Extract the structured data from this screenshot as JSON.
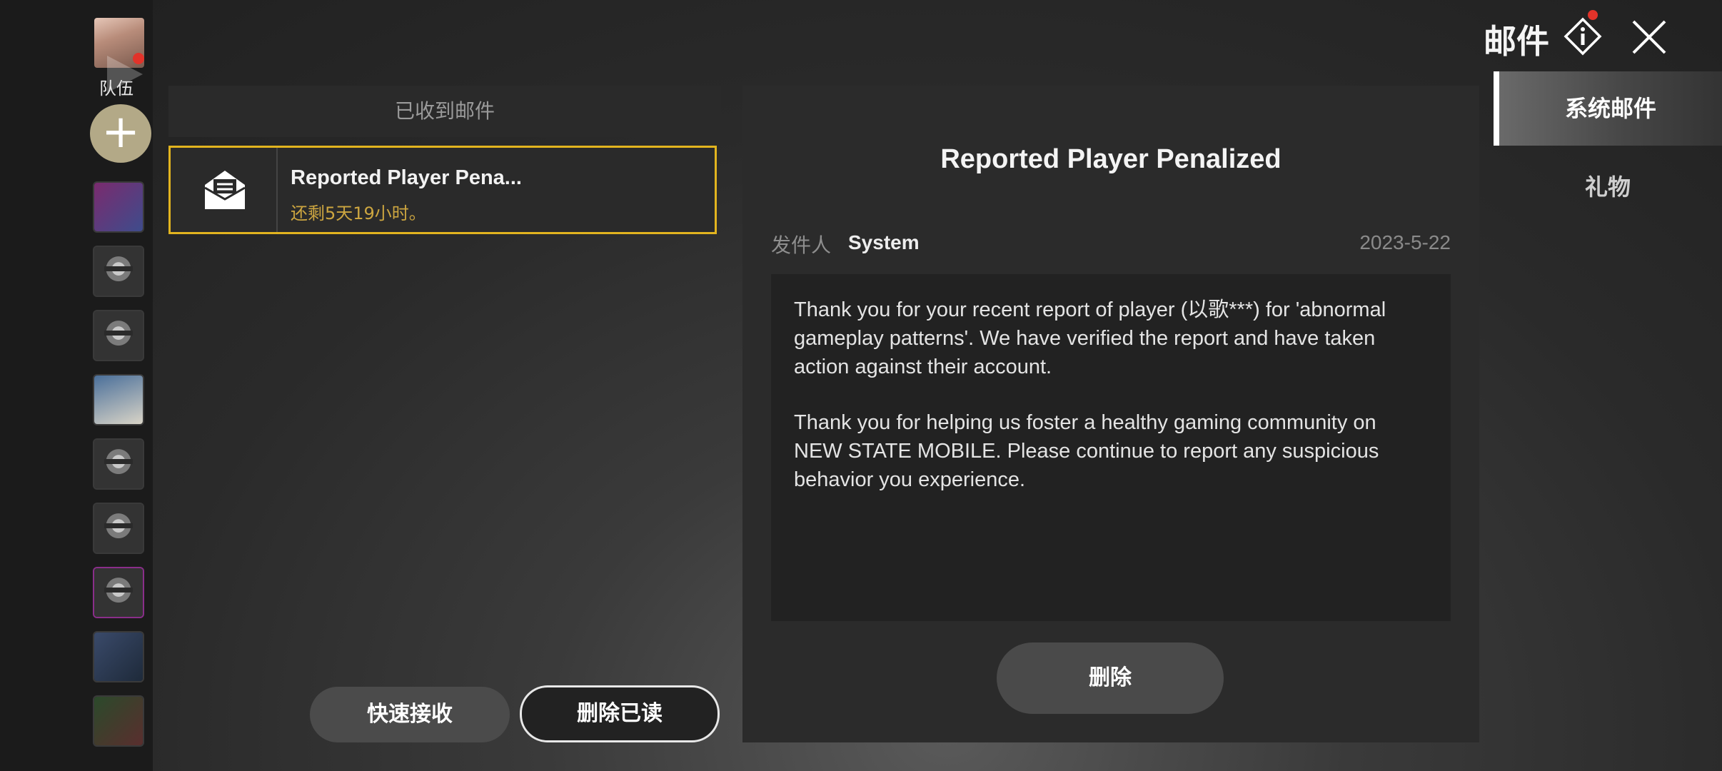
{
  "sidebar": {
    "team_label": "队伍",
    "add_label": "+"
  },
  "inbox": {
    "header": "已收到邮件",
    "items": [
      {
        "title": "Reported Player Pena...",
        "expires": "还剩5天19小时。"
      }
    ],
    "quick_receive_label": "快速接收",
    "delete_read_label": "删除已读"
  },
  "detail": {
    "title": "Reported Player Penalized",
    "sender_label": "发件人",
    "sender": "System",
    "date": "2023-5-22",
    "body_p1": "Thank you for your recent report of player (以歌***) for 'abnormal gameplay patterns'. We have verified the report and have taken action against their account.",
    "body_p2": "Thank you for helping us foster a healthy gaming community on NEW STATE MOBILE. Please continue to report any suspicious behavior you experience.",
    "delete_label": "删除"
  },
  "header": {
    "title": "邮件"
  },
  "tabs": {
    "system_mail": "系统邮件",
    "gifts": "礼物"
  },
  "colors": {
    "accent_yellow": "#e2b41f",
    "expiry_text": "#cda640",
    "notification_red": "#e2332a"
  }
}
